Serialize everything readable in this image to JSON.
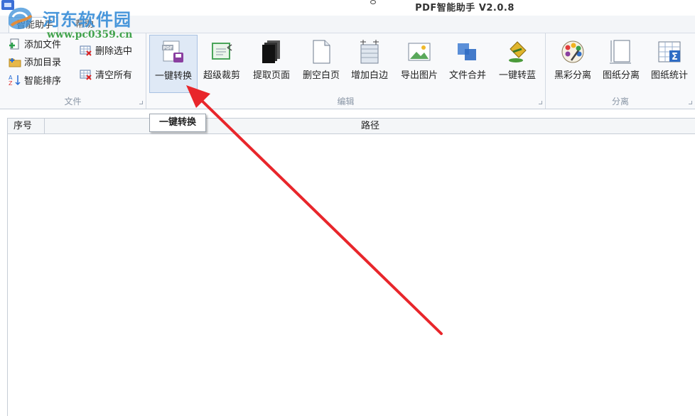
{
  "window": {
    "title": "PDF智能助手 V2.0.8"
  },
  "watermark": {
    "title": "河东软件园",
    "url": "www.pc0359.cn"
  },
  "menu_tabs": [
    {
      "label": "智能助手",
      "active": true
    },
    {
      "label": "帮助",
      "active": false
    }
  ],
  "ribbon": {
    "groups": [
      {
        "label": "文件",
        "small_buttons": [
          {
            "label": "添加文件",
            "icon": "add-file-icon"
          },
          {
            "label": "添加目录",
            "icon": "add-folder-icon"
          },
          {
            "label": "智能排序",
            "icon": "sort-icon"
          },
          {
            "label": "删除选中",
            "icon": "delete-selected-icon"
          },
          {
            "label": "清空所有",
            "icon": "clear-all-icon"
          }
        ]
      },
      {
        "label": "编辑",
        "big_buttons": [
          {
            "label": "一键转换",
            "icon": "pdf-convert-icon",
            "selected": true
          },
          {
            "label": "超级裁剪",
            "icon": "crop-icon"
          },
          {
            "label": "提取页面",
            "icon": "extract-pages-icon"
          },
          {
            "label": "删空白页",
            "icon": "blank-page-icon"
          },
          {
            "label": "增加白边",
            "icon": "add-margin-icon"
          },
          {
            "label": "导出图片",
            "icon": "export-image-icon"
          },
          {
            "label": "文件合并",
            "icon": "merge-icon"
          },
          {
            "label": "一键转蓝",
            "icon": "paint-bucket-icon"
          }
        ]
      },
      {
        "label": "分离",
        "big_buttons": [
          {
            "label": "黑彩分离",
            "icon": "color-palette-icon"
          },
          {
            "label": "图纸分离",
            "icon": "drawing-icon"
          },
          {
            "label": "图纸统计",
            "icon": "statistics-icon"
          }
        ]
      }
    ]
  },
  "tooltip": {
    "text": "一键转换"
  },
  "table": {
    "columns": [
      "序号",
      "路径"
    ],
    "rows": []
  },
  "colors": {
    "annotation_arrow": "#e8262b",
    "selected_button": "#dfe9f6",
    "watermark_title": "#3a8fd8",
    "watermark_url": "#2f9a3a"
  }
}
